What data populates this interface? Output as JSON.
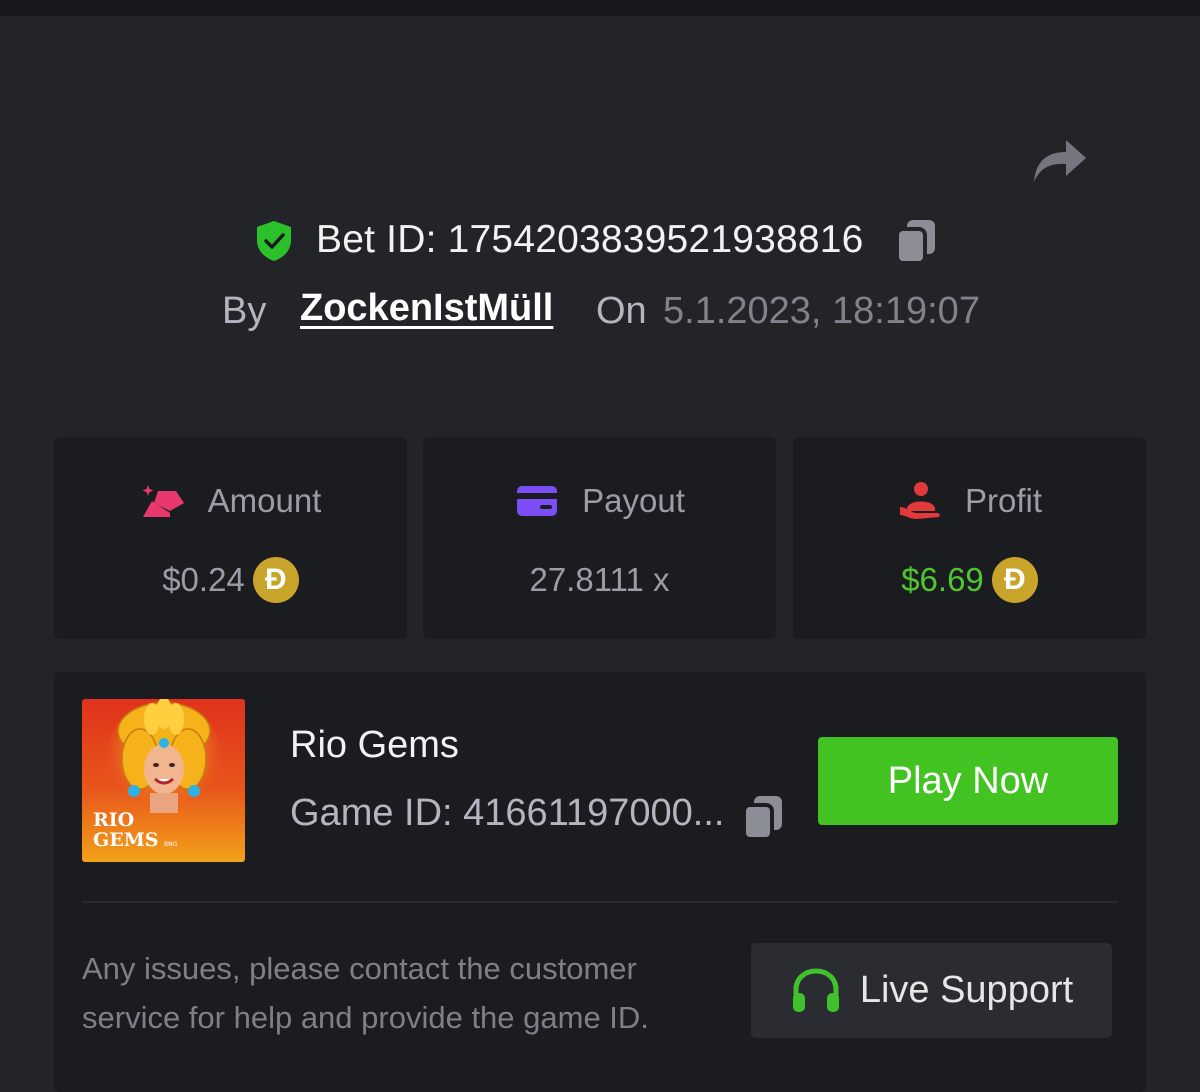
{
  "header": {
    "bet_id_label": "Bet ID: 1754203839521938816",
    "by_label": "By",
    "username": "ZockenIstMüll",
    "on_label": "On",
    "datetime": "5.1.2023, 18:19:07"
  },
  "stats": {
    "amount": {
      "label": "Amount",
      "value": "$0.24",
      "currency_icon": "doge-coin-icon"
    },
    "payout": {
      "label": "Payout",
      "value": "27.8111 x"
    },
    "profit": {
      "label": "Profit",
      "value": "$6.69",
      "currency_icon": "doge-coin-icon"
    }
  },
  "game": {
    "name": "Rio Gems",
    "id_label": "Game ID: 41661197000...",
    "thumbnail_text_line1": "RIO",
    "thumbnail_text_line2": "GEMS",
    "thumbnail_brand": "BNG",
    "play_label": "Play Now"
  },
  "support": {
    "message": "Any issues, please contact the customer service for help and provide the game ID.",
    "button_label": "Live Support"
  },
  "colors": {
    "background": "#232428",
    "card": "#1b1c20",
    "accent_green": "#43c322",
    "profit_green": "#4ec62d",
    "doge_gold": "#c8a42b",
    "amount_icon": "#e8386d",
    "payout_icon": "#7b4df4",
    "profit_icon": "#e23a3a"
  }
}
